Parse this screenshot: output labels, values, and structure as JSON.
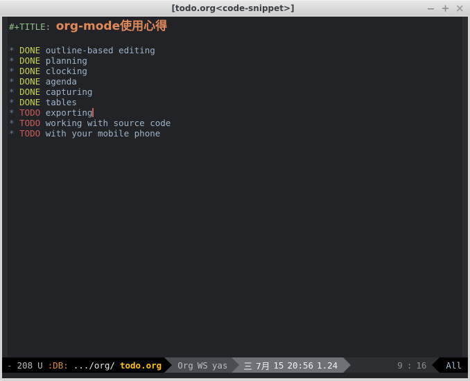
{
  "window": {
    "title": "[todo.org<code-snippet>]",
    "controls": [
      {
        "name": "minimize",
        "glyph": "−"
      },
      {
        "name": "maximize",
        "glyph": "+"
      },
      {
        "name": "close",
        "glyph": "×"
      }
    ]
  },
  "colors": {
    "background": "#222326",
    "fringe": "#2b2c30",
    "titlebar": "#dcdcdc",
    "keyword_green": "#8fc08a",
    "title_orange": "#e2895c",
    "done_yellow": "#c9d356",
    "todo_red": "#cd5c5c",
    "body_blue": "#9fb3c9",
    "star_grey": "#6d7b92",
    "modeline_accent_orange": "#e08a2e",
    "modeline_file_yellow": "#ffc300",
    "cursor": "#d06060"
  },
  "buffer": {
    "title_directive": "#+TITLE:",
    "title_text": "org-mode使用心得",
    "headings": [
      {
        "bullet": "*",
        "keyword": "DONE",
        "text": "outline-based editing",
        "cursor": false
      },
      {
        "bullet": "*",
        "keyword": "DONE",
        "text": "planning",
        "cursor": false
      },
      {
        "bullet": "*",
        "keyword": "DONE",
        "text": "clocking",
        "cursor": false
      },
      {
        "bullet": "*",
        "keyword": "DONE",
        "text": "agenda",
        "cursor": false
      },
      {
        "bullet": "*",
        "keyword": "DONE",
        "text": "capturing",
        "cursor": false
      },
      {
        "bullet": "*",
        "keyword": "DONE",
        "text": "tables",
        "cursor": false
      },
      {
        "bullet": "*",
        "keyword": "TODO",
        "text": "exporting",
        "cursor": true
      },
      {
        "bullet": "*",
        "keyword": "TODO",
        "text": "working with source code",
        "cursor": false
      },
      {
        "bullet": "*",
        "keyword": "TODO",
        "text": "with your mobile phone",
        "cursor": false
      }
    ]
  },
  "modeline": {
    "modified_flag": "-",
    "buffer_size": "208",
    "encoding": "U",
    "project_tag": ":DB:",
    "path_prefix": ".../org/",
    "file_name": "todo.org",
    "major_mode": "Org",
    "minor_modes": [
      "WS",
      "yas"
    ],
    "clock": {
      "weekday": "三",
      "month": "7月",
      "day": "15",
      "time": "20:56",
      "load": "1.24"
    },
    "position": {
      "line": "9",
      "separator": ":",
      "column": "16"
    },
    "scroll_percent": "All"
  }
}
